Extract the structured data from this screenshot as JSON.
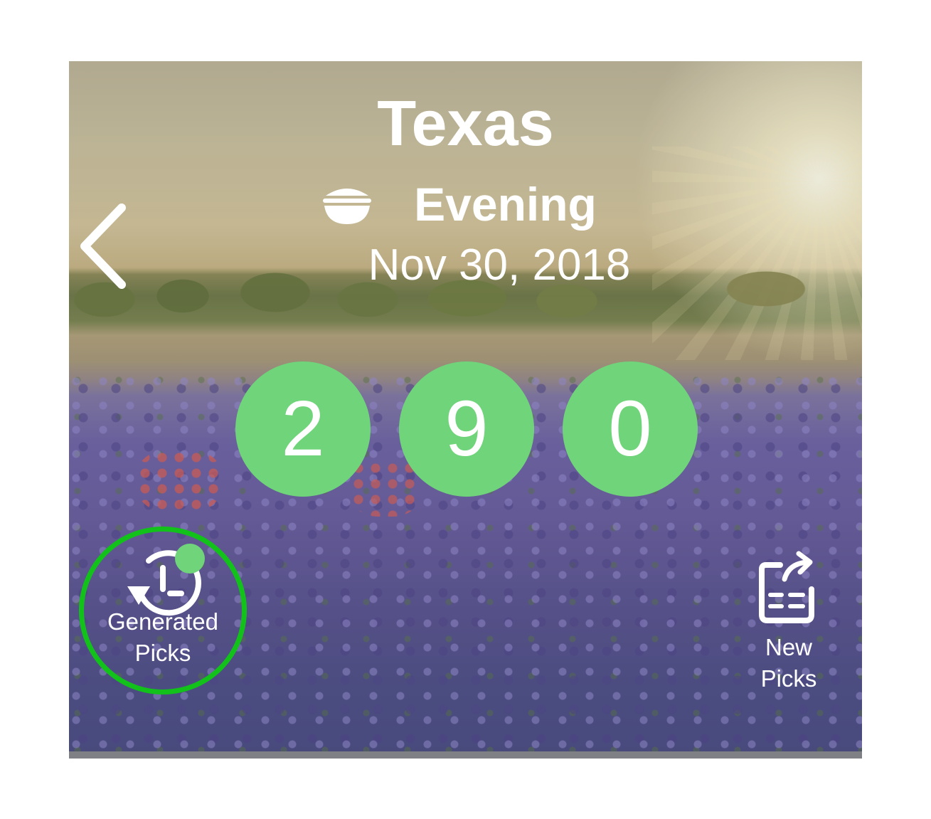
{
  "header": {
    "state": "Texas",
    "draw_time": "Evening",
    "draw_icon": "evening-bowl-icon",
    "date": "Nov 30, 2018"
  },
  "navigation": {
    "back_icon": "chevron-left-icon"
  },
  "winning_numbers": [
    "2",
    "9",
    "0"
  ],
  "actions": {
    "generated_picks": {
      "line1": "Generated",
      "line2": "Picks",
      "icon": "history-clock-icon",
      "has_notification": true
    },
    "new_picks": {
      "line1": "New",
      "line2": "Picks",
      "icon": "share-ticket-icon"
    }
  },
  "colors": {
    "ball": "#6fd47a",
    "highlight_ring": "#12c21a",
    "text": "#ffffff"
  }
}
